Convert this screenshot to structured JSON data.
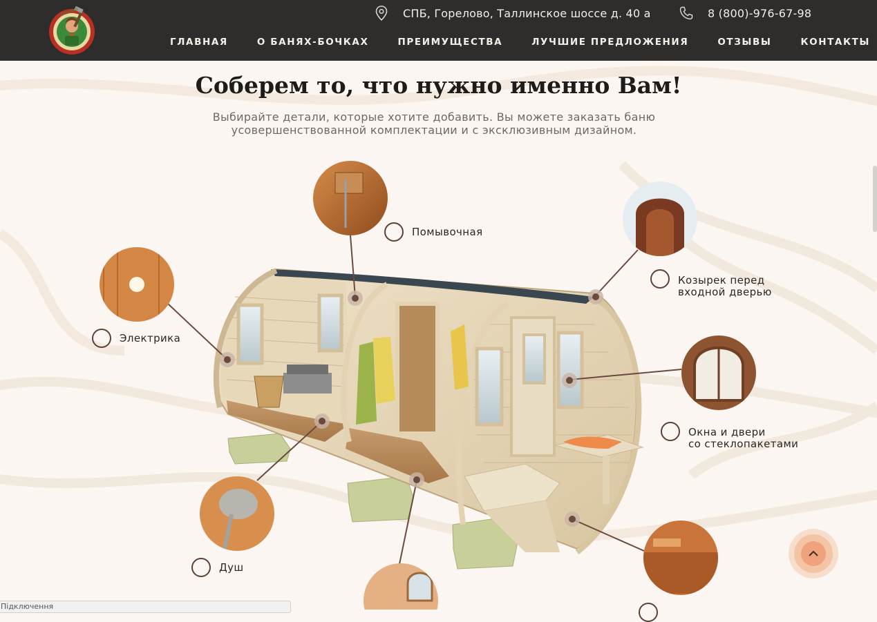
{
  "header": {
    "address": "СПБ, Горелово, Таллинское шоссе д. 40 а",
    "phone": "8 (800)-976-67-98",
    "nav": [
      "ГЛАВНАЯ",
      "О БАНЯХ-БОЧКАХ",
      "ПРЕИМУЩЕСТВА",
      "ЛУЧШИЕ ПРЕДЛОЖЕНИЯ",
      "ОТЗЫВЫ",
      "КОНТАКТЫ"
    ]
  },
  "section": {
    "title": "Соберем то, что нужно именно Вам!",
    "subtitle": "Выбирайте детали, которые хотите добавить. Вы можете заказать баню усовершенствованной комплектации и с эксклюзивным дизайном."
  },
  "features": {
    "washroom": "Помывочная",
    "canopy_line1": "Козырек перед",
    "canopy_line2": "входной дверью",
    "electrics": "Электрика",
    "windows_line1": "Окна и двери",
    "windows_line2": "со стеклопакетами",
    "shower": "Душ"
  },
  "status": {
    "text": "Підключення"
  },
  "colors": {
    "header_bg": "#2f2d2b",
    "accent_ring": "#5b4137",
    "to_top": "#efa27d"
  }
}
